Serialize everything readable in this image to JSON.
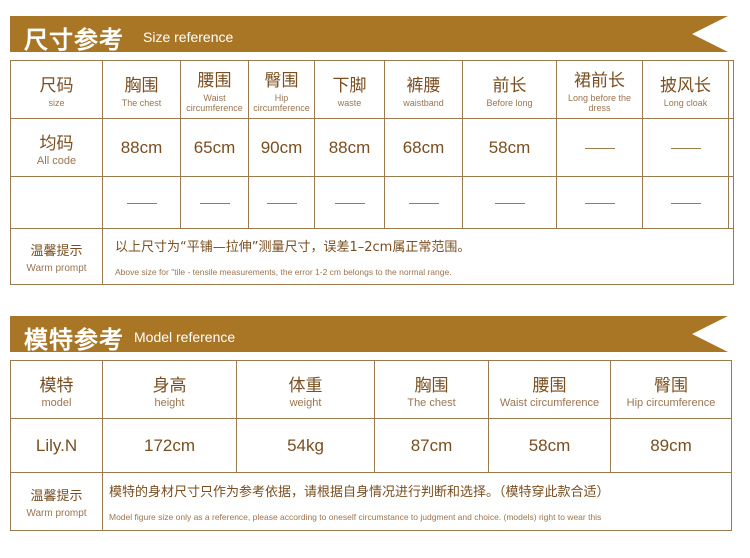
{
  "size_section": {
    "title_zh": "尺寸参考",
    "title_en": "Size reference",
    "headers": [
      {
        "zh": "尺码",
        "en": "size"
      },
      {
        "zh": "胸围",
        "en": "The chest"
      },
      {
        "zh": "腰围",
        "en": "Waist circumference"
      },
      {
        "zh": "臀围",
        "en": "Hip circumference"
      },
      {
        "zh": "下脚",
        "en": "waste"
      },
      {
        "zh": "裤腰",
        "en": "waistband"
      },
      {
        "zh": "前长",
        "en": "Before long"
      },
      {
        "zh": "裙前长",
        "en": "Long before the dress"
      },
      {
        "zh": "披风长",
        "en": "Long cloak"
      }
    ],
    "row1": {
      "label_zh": "均码",
      "label_en": "All code",
      "values": [
        "88cm",
        "65cm",
        "90cm",
        "88cm",
        "68cm",
        "58cm"
      ]
    },
    "prompt": {
      "label_zh": "温馨提示",
      "label_en": "Warm prompt",
      "text_zh": "以上尺寸为“平铺—拉伸”测量尺寸，误差1–2cm属正常范围。",
      "text_en": "Above size for \"tile - tensile measurements, the error 1-2 cm belongs to the normal range."
    }
  },
  "model_section": {
    "title_zh": "模特参考",
    "title_en": "Model reference",
    "headers": [
      {
        "zh": "模特",
        "en": "model"
      },
      {
        "zh": "身高",
        "en": "height"
      },
      {
        "zh": "体重",
        "en": "weight"
      },
      {
        "zh": "胸围",
        "en": "The chest"
      },
      {
        "zh": "腰围",
        "en": "Waist circumference"
      },
      {
        "zh": "臀围",
        "en": "Hip circumference"
      }
    ],
    "values": [
      "Lily.N",
      "172cm",
      "54kg",
      "87cm",
      "58cm",
      "89cm"
    ],
    "prompt": {
      "label_zh": "温馨提示",
      "label_en": "Warm prompt",
      "text_zh": "模特的身材尺寸只作为参考依据，请根据自身情况进行判断和选择。（模特穿此款合适）",
      "text_en": "Model figure size only as a reference, please according to oneself circumstance to judgment and choice. (models) right to wear this"
    }
  }
}
